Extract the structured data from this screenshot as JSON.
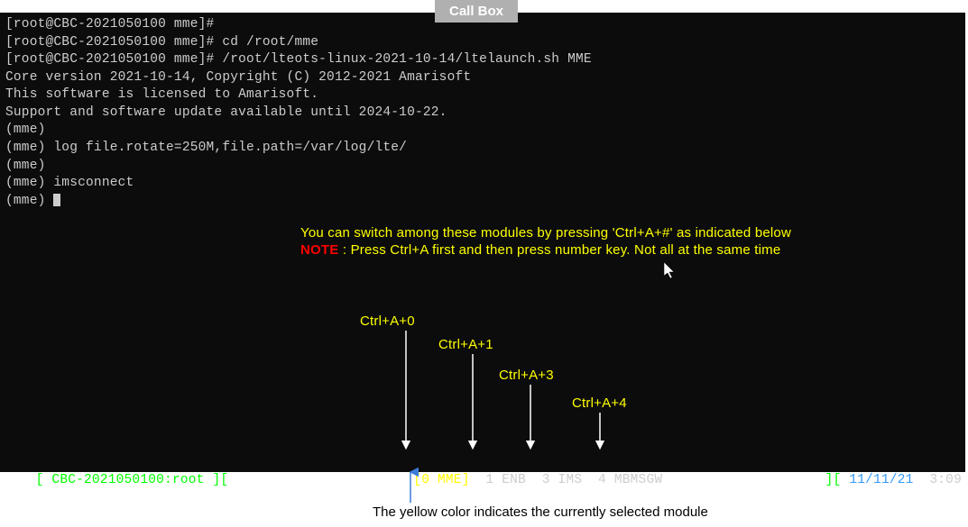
{
  "callbox_label": "Call Box",
  "term": {
    "l1": "[root@CBC-2021050100 mme]#",
    "l2": "[root@CBC-2021050100 mme]# cd /root/mme",
    "l3": "[root@CBC-2021050100 mme]# /root/lteots-linux-2021-10-14/ltelaunch.sh MME",
    "l4": "Core version 2021-10-14, Copyright (C) 2012-2021 Amarisoft",
    "l5": "This software is licensed to Amarisoft.",
    "l6": "Support and software update available until 2024-10-22.",
    "l7": "",
    "l8": "(mme)",
    "l9": "(mme) log file.rotate=250M,file.path=/var/log/lte/",
    "l10": "(mme)",
    "l11": "(mme) imsconnect",
    "l12": "(mme) "
  },
  "annot": {
    "switch_text": "You can switch among these modules by pressing 'Ctrl+A+#' as indicated below",
    "note_label": "NOTE",
    "note_text": " : Press Ctrl+A first and then press number key. Not all at the same time"
  },
  "shortcuts": {
    "s0": "Ctrl+A+0",
    "s1": "Ctrl+A+1",
    "s3": "Ctrl+A+3",
    "s4": "Ctrl+A+4"
  },
  "status": {
    "left_bracket_open": "[ ",
    "host": "CBC-2021050100:root",
    "left_bracket_close": " ][",
    "mod0_pre": "[",
    "mod0_num": "0 ",
    "mod0_name": "MME",
    "mod0_post": "]",
    "mod1": "  1 ENB",
    "mod3": "  3 IMS",
    "mod4": "  4 MBMSGW",
    "right_open": "][ ",
    "date": "11/11/21",
    "time": "  3:09"
  },
  "caption": "The yellow color indicates the currently selected module"
}
